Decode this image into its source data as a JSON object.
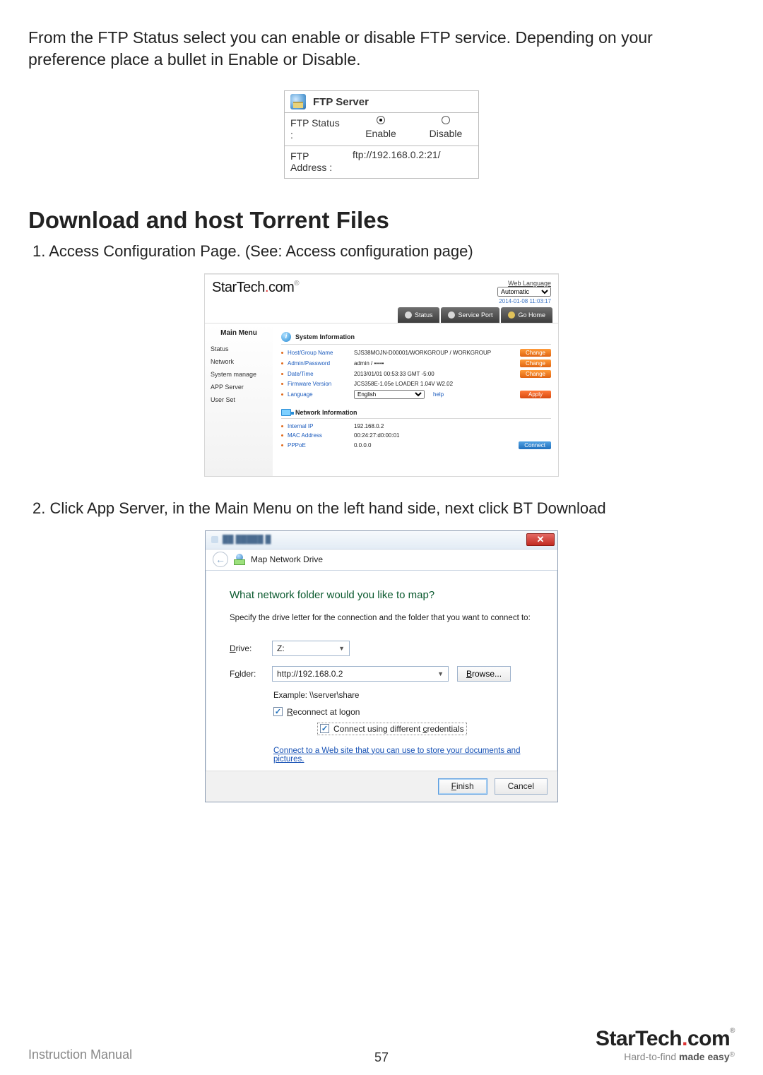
{
  "intro": "From the FTP Status select you can enable or disable FTP service. Depending on your preference place a bullet in Enable or Disable.",
  "ftp": {
    "title": "FTP Server",
    "status_label": "FTP Status :",
    "enable": "Enable",
    "disable": "Disable",
    "address_label": "FTP Address :",
    "address_value": "ftp://192.168.0.2:21/"
  },
  "heading": "Download and host Torrent Files",
  "step1": "1.  Access Configuration Page. (See: Access configuration page)",
  "step2": "2.  Click App Server, in the Main Menu on the left hand side, next click BT Download",
  "webui": {
    "logo_a": "StarTech",
    "logo_b": "com",
    "weblang_label": "Web Language",
    "weblang_value": "Automatic",
    "timestamp": "2014-01-08 11:03:17",
    "btn_status": "Status",
    "btn_service": "Service Port",
    "btn_home": "Go Home",
    "sidebar_title": "Main Menu",
    "sidebar": [
      "Status",
      "Network",
      "System manage",
      "APP Server",
      "User Set"
    ],
    "sys_head": "System Information",
    "rows_sys": [
      {
        "key": "Host/Group Name",
        "val": "SJS38MOJN-D00001/WORKGROUP / WORKGROUP",
        "btn": "Change"
      },
      {
        "key": "Admin/Password",
        "val": "admin / •••••",
        "btn": "Change"
      },
      {
        "key": "Date/Time",
        "val": "2013/01/01 00:53:33 GMT -5:00",
        "btn": "Change"
      },
      {
        "key": "Firmware Version",
        "val": "JCS358E-1.05e LOADER 1.04V W2.02",
        "btn": ""
      }
    ],
    "lang_key": "Language",
    "lang_val": "English",
    "lang_help": "help",
    "lang_btn": "Apply",
    "net_head": "Network Information",
    "rows_net": [
      {
        "key": "Internal IP",
        "val": "192.168.0.2",
        "btn": ""
      },
      {
        "key": "MAC Address",
        "val": "00:24:27:d0:00:01",
        "btn": ""
      },
      {
        "key": "PPPoE",
        "val": "0.0.0.0",
        "btn": "Connect"
      }
    ]
  },
  "dlg": {
    "title": "Map Network Drive",
    "question": "What network folder would you like to map?",
    "sub": "Specify the drive letter for the connection and the folder that you want to connect to:",
    "drive_label": "Drive:",
    "drive_value": "Z:",
    "folder_label": "Folder:",
    "folder_value": "http://192.168.0.2",
    "browse": "Browse...",
    "example": "Example: \\\\server\\share",
    "reconnect": "Reconnect at logon",
    "diffcred": "Connect using different credentials",
    "link": "Connect to a Web site that you can use to store your documents and pictures.",
    "finish": "Finish",
    "cancel": "Cancel"
  },
  "footer": {
    "left": "Instruction Manual",
    "page": "57",
    "logo_a": "StarTech",
    "logo_b": "com",
    "tag_a": "Hard-to-find ",
    "tag_b": "made easy"
  }
}
